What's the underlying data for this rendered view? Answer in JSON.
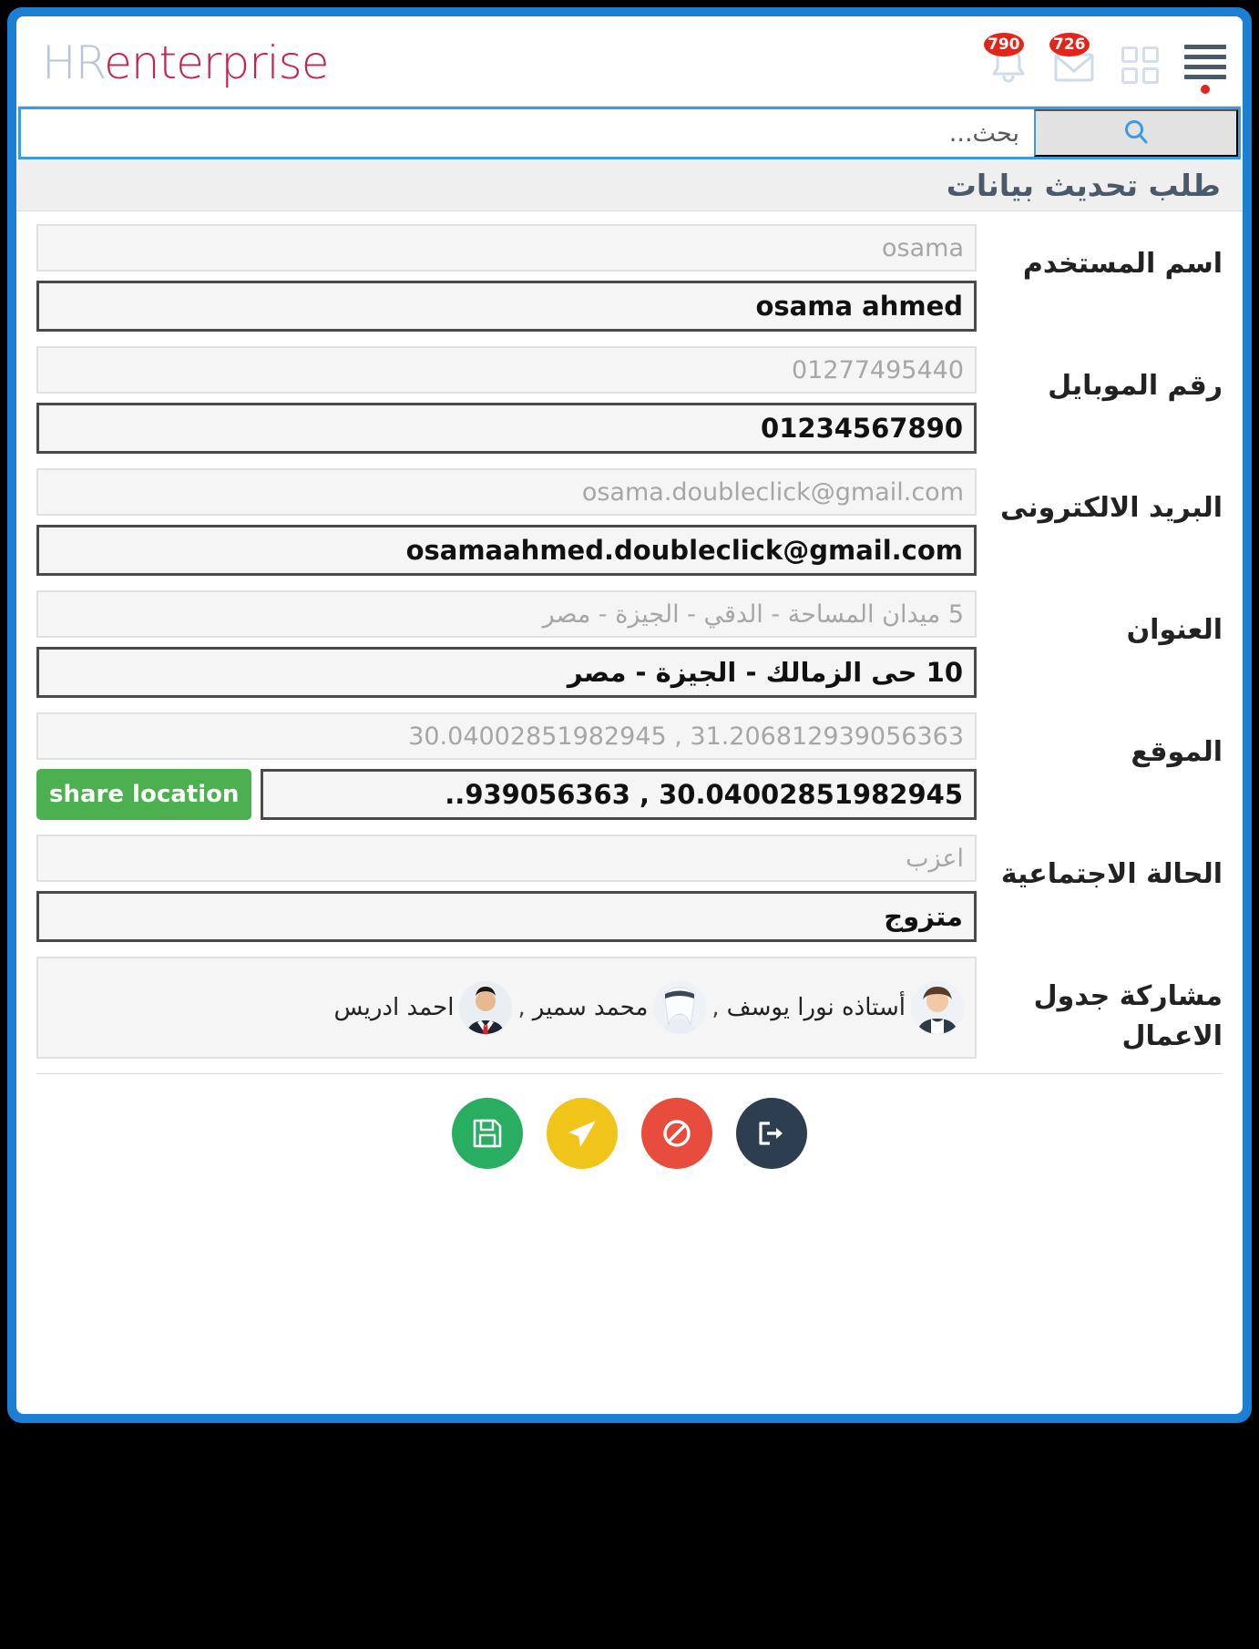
{
  "brand": {
    "part1": "HR",
    "part2": "enterprise"
  },
  "header": {
    "notifications_badge": "790",
    "messages_badge": "726",
    "bell_icon": "bell-icon",
    "envelope_icon": "envelope-icon",
    "grid_icon": "grid-apps-icon",
    "menu_icon": "hamburger-menu-icon"
  },
  "search": {
    "placeholder": "بحث...",
    "value": "",
    "button_icon": "search-icon"
  },
  "page": {
    "title": "طلب تحديث بيانات"
  },
  "form": {
    "rows": [
      {
        "label": "اسم المستخدم",
        "old_value": "osama",
        "new_value": "osama ahmed",
        "dir": "ltr"
      },
      {
        "label": "رقم الموبايل",
        "old_value": "01277495440",
        "new_value": "01234567890",
        "dir": "ltr"
      },
      {
        "label": "البريد الالكترونى",
        "old_value": "osama.doubleclick@gmail.com",
        "new_value": "osamaahmed.doubleclick@gmail.com",
        "dir": "ltr"
      },
      {
        "label": "العنوان",
        "old_value": "5 ميدان المساحة - الدقي - الجيزة - مصر",
        "new_value": "10 حى الزمالك - الجيزة - مصر",
        "dir": "rtl"
      },
      {
        "label": "الموقع",
        "old_value": "30.04002851982945 , 31.206812939056363",
        "new_value": "..939056363 , 30.04002851982945",
        "dir": "ltr",
        "share_button": "share location"
      },
      {
        "label": "الحالة الاجتماعية",
        "old_value": "اعزب",
        "new_value": "متزوج",
        "dir": "rtl"
      }
    ],
    "share_schedule": {
      "label": "مشاركة جدول الاعمال",
      "people": [
        {
          "name": "أستاذه نورا يوسف",
          "avatar": "woman-avatar",
          "separator": ","
        },
        {
          "name": "محمد سمير",
          "avatar": "man-keffiyeh-avatar",
          "separator": ","
        },
        {
          "name": "احمد ادريس",
          "avatar": "man-suit-avatar",
          "separator": ""
        }
      ]
    }
  },
  "actions": [
    {
      "name": "save",
      "icon": "floppy-disk-icon",
      "color": "#27ae60"
    },
    {
      "name": "send",
      "icon": "paper-plane-icon",
      "color": "#f0c419"
    },
    {
      "name": "reject",
      "icon": "ban-icon",
      "color": "#e74c3c"
    },
    {
      "name": "exit",
      "icon": "exit-icon",
      "color": "#2c3e50"
    }
  ],
  "colors": {
    "frame_blue": "#1b7fd4",
    "accent_blue": "#3d9ae0",
    "brand_pink": "#c52350",
    "brand_gray": "#b9c5d6",
    "badge_red": "#e0251b",
    "green": "#4caf50"
  }
}
